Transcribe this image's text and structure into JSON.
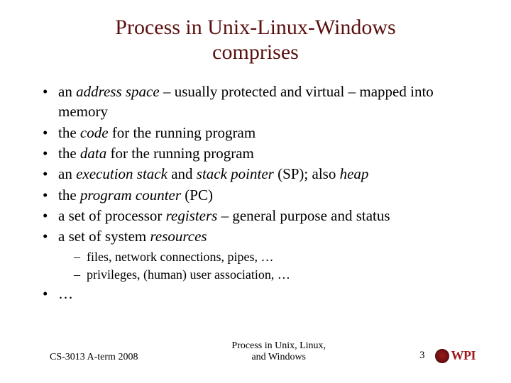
{
  "title_line1": "Process in Unix-Linux-Windows",
  "title_line2": "comprises",
  "bullets": {
    "b1_pre": "an ",
    "b1_em": "address space",
    "b1_post": " – usually protected and virtual – mapped into memory",
    "b2_pre": "the ",
    "b2_em": "code",
    "b2_post": " for the running program",
    "b3_pre": "the ",
    "b3_em": "data",
    "b3_post": " for the running program",
    "b4_pre": "an ",
    "b4_em1": "execution stack",
    "b4_mid1": " and ",
    "b4_em2": "stack pointer",
    "b4_mid2": " (SP); also ",
    "b4_em3": "heap",
    "b5_pre": "the ",
    "b5_em": "program counter",
    "b5_post": " (PC)",
    "b6_pre": "a set of processor ",
    "b6_em": "registers",
    "b6_post": " – general purpose and status",
    "b7_pre": "a set of system ",
    "b7_em": "resources",
    "sub1": "files, network connections, pipes, …",
    "sub2": "privileges, (human) user association, …",
    "b8": "…"
  },
  "footer": {
    "left": "CS-3013 A-term 2008",
    "center_line1": "Process in Unix, Linux,",
    "center_line2": "and Windows",
    "page": "3",
    "logo_text": "WPI"
  }
}
